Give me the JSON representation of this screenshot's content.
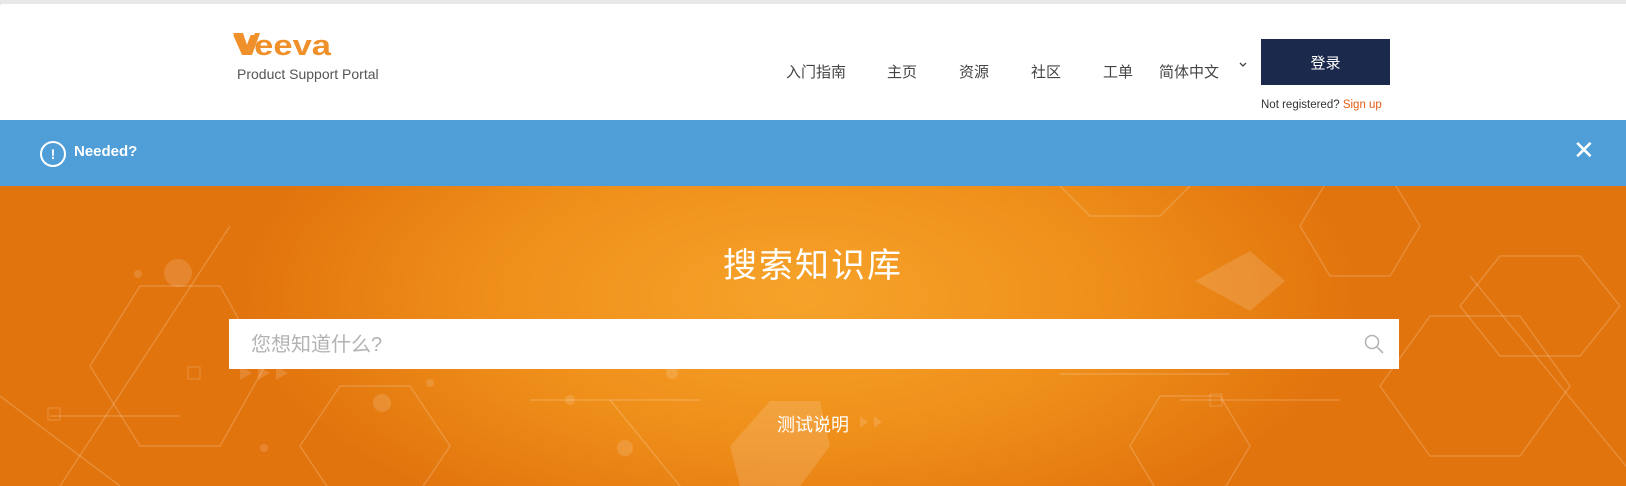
{
  "brand": {
    "logo_text": "Veeva",
    "subtitle": "Product Support Portal",
    "logo_color": "#f0902a"
  },
  "nav": {
    "items": [
      {
        "label": "入门指南"
      },
      {
        "label": "主页"
      },
      {
        "label": "资源"
      },
      {
        "label": "社区"
      },
      {
        "label": "工单"
      }
    ],
    "language": {
      "selected": "简体中文",
      "icon": "chevron-down-icon"
    }
  },
  "auth": {
    "login_label": "登录",
    "register_prompt": "Not registered?",
    "signup_label": "Sign up",
    "signup_color": "#e35d12",
    "button_color": "#1b2a4c"
  },
  "notice": {
    "text": "Needed?",
    "icon_text": "!",
    "close_symbol": "✕",
    "color": "#4f9ed8"
  },
  "hero": {
    "title": "搜索知识库",
    "search_placeholder": "您想知道什么?",
    "search_value": "",
    "link_label": "测试说明",
    "colors": [
      "#f6a32a",
      "#ef8f1a",
      "#e2740d"
    ]
  }
}
